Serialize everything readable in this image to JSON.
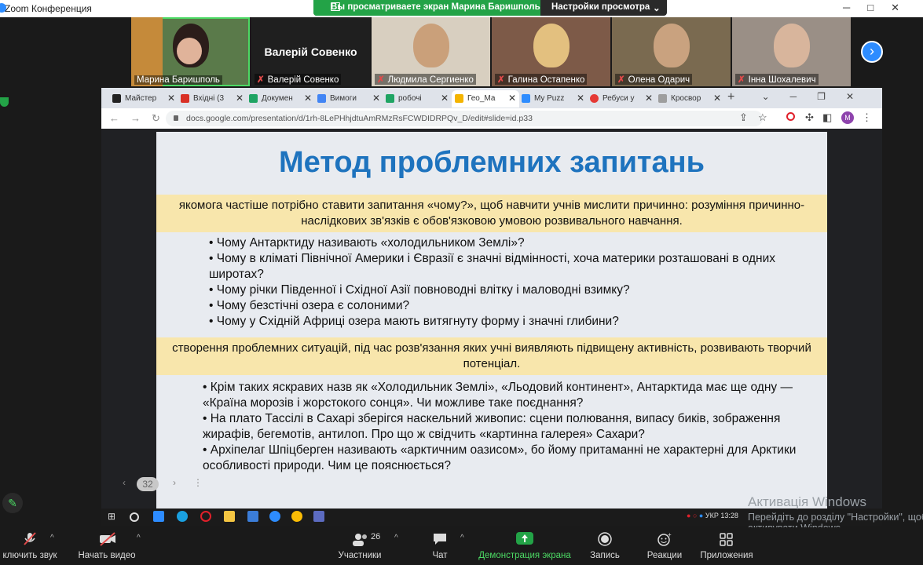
{
  "app": {
    "title": "Zoom Конференция"
  },
  "share_banner": {
    "text": "Вы просматриваете экран Марина Баришполь",
    "options": "Настройки просмотра"
  },
  "participants": [
    {
      "name": "Марина Баришполь",
      "muted": false,
      "active": true
    },
    {
      "name": "Валерій Совенко",
      "muted": true,
      "video": false
    },
    {
      "name": "Людмила Сергиенко",
      "muted": true
    },
    {
      "name": "Галина Остапенко",
      "muted": true
    },
    {
      "name": "Олена Одарич",
      "muted": true
    },
    {
      "name": "Інна Шохалевич",
      "muted": true
    }
  ],
  "browser": {
    "tabs": [
      "Майстер",
      "Вхідні (3",
      "Докумен",
      "Вимоги",
      "робочі",
      "Гео_Ма",
      "My Puzz",
      "Ребуси у",
      "Кросвор"
    ],
    "active_tab": 5,
    "url": "docs.google.com/presentation/d/1rh-8LePHhjdtuAmRMzRsFCWDIDRPQv_D/edit#slide=id.p33",
    "profile_letter": "M"
  },
  "slide": {
    "title": "Метод проблемних запитань",
    "band1": "якомога частіше потрібно ставити запитання «чому?», щоб навчити учнів мислити причинно: розуміння причинно-наслідкових зв'язків є обов'язковою умовою розвивального навчання.",
    "bullets1": [
      "• Чому Антарктиду називають «холодильником Землі»?",
      "• Чому в кліматі Північної Америки і Євразії є значні відмінності, хоча материки розташовані в одних широтах?",
      "• Чому річки Південної і Східної Азії повноводні влітку і маловодні взимку?",
      "• Чому безстічні озера є солоними?",
      "• Чому у Східній Африці озера мають витягнуту форму і значні глибини?"
    ],
    "band2": "створення проблемних ситуацій, під час розв'язання яких учні виявляють підвищену активність, розвивають творчий потенціал.",
    "bullets2": [
      "• Крім таких яскравих назв як «Холодильник Землі», «Льодовий континент», Антарктида має ще одну — «Країна морозів і жорстокого сонця». Чи можливе таке поєднання?",
      "• На плато Тассілі в Сахарі зберігся наскельний живопис: сцени полювання, випасу биків, зображення жирафів, бегемотів, антилоп. Про що ж свідчить «картинна галерея» Сахари?",
      "• Архіпелаг Шпіцберген називають «арктичним оазисом», бо йому притаманні не характерні для Арктики особливості природи. Чим це пояснюється?"
    ],
    "page_number": "32"
  },
  "taskbar": {
    "tray": "УКР",
    "time": "13:28"
  },
  "activation": {
    "line1": "Активація Windows",
    "line2": "Перейдіть до розділу \"Настройки\", щоб активувати Windows."
  },
  "toolbar": {
    "mute": "ключить звук",
    "video": "Начать видео",
    "participants": "Участники",
    "participants_count": "26",
    "chat": "Чат",
    "share": "Демонстрация экрана",
    "record": "Запись",
    "reactions": "Реакции",
    "apps": "Приложения"
  }
}
